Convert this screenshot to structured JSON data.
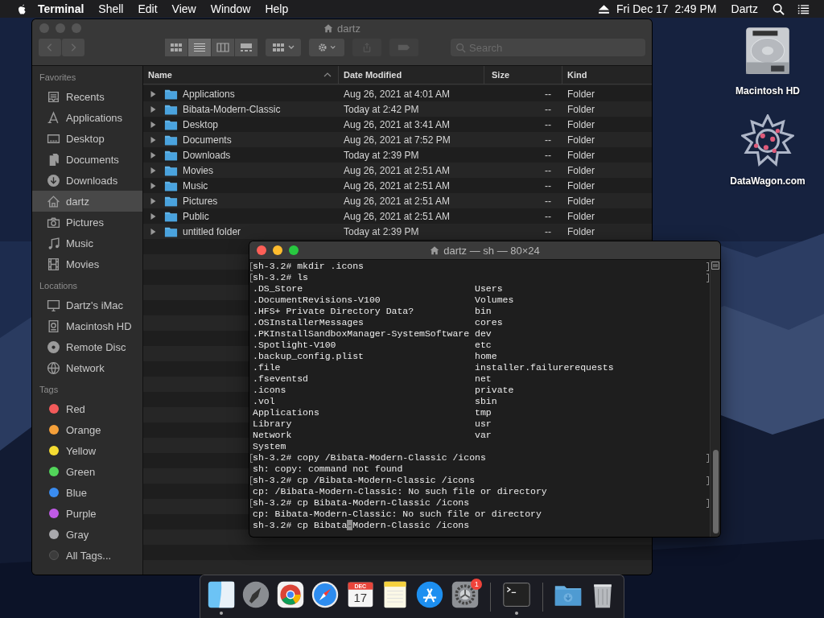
{
  "menu_bar": {
    "app": "Terminal",
    "menus": [
      "Shell",
      "Edit",
      "View",
      "Window",
      "Help"
    ],
    "clock": "Fri Dec 17  2:49 PM",
    "user": "Dartz"
  },
  "finder": {
    "title": "dartz",
    "views": [
      {
        "selected": false
      },
      {
        "selected": true
      },
      {
        "selected": false
      },
      {
        "selected": false
      }
    ],
    "search": {
      "placeholder": "Search"
    },
    "sidebar": [
      {
        "heading": "Favorites",
        "items": [
          {
            "label": "Recents",
            "selected": false
          },
          {
            "label": "Applications",
            "selected": false
          },
          {
            "label": "Desktop",
            "selected": false
          },
          {
            "label": "Documents",
            "selected": false
          },
          {
            "label": "Downloads",
            "selected": false
          },
          {
            "label": "dartz",
            "selected": true
          },
          {
            "label": "Pictures",
            "selected": false
          },
          {
            "label": "Music",
            "selected": false
          },
          {
            "label": "Movies",
            "selected": false
          }
        ]
      },
      {
        "heading": "Locations",
        "items": [
          {
            "label": "Dartz's iMac",
            "selected": false
          },
          {
            "label": "Macintosh HD",
            "selected": false
          },
          {
            "label": "Remote Disc",
            "selected": false
          },
          {
            "label": "Network",
            "selected": false
          }
        ]
      }
    ],
    "tags": {
      "heading": "Tags",
      "items": [
        {
          "label": "Red",
          "color": "#f25a5a"
        },
        {
          "label": "Orange",
          "color": "#f5a03a"
        },
        {
          "label": "Yellow",
          "color": "#f5dc32"
        },
        {
          "label": "Green",
          "color": "#52d65a"
        },
        {
          "label": "Blue",
          "color": "#3a8cf0"
        },
        {
          "label": "Purple",
          "color": "#c05ae6"
        },
        {
          "label": "Gray",
          "color": "#a8a8ac"
        }
      ],
      "all": "All Tags..."
    },
    "columns": [
      "Name",
      "Date Modified",
      "Size",
      "Kind"
    ],
    "rows": [
      {
        "name": "Applications",
        "date": "Aug 26, 2021 at 4:01 AM",
        "size": "--",
        "kind": "Folder",
        "expanded": false,
        "selected": false
      },
      {
        "name": "Bibata-Modern-Classic",
        "date": "Today at 2:42 PM",
        "size": "--",
        "kind": "Folder",
        "expanded": false,
        "selected": false
      },
      {
        "name": "Desktop",
        "date": "Aug 26, 2021 at 3:41 AM",
        "size": "--",
        "kind": "Folder",
        "expanded": false,
        "selected": false
      },
      {
        "name": "Documents",
        "date": "Aug 26, 2021 at 7:52 PM",
        "size": "--",
        "kind": "Folder",
        "expanded": false,
        "selected": false
      },
      {
        "name": "Downloads",
        "date": "Today at 2:39 PM",
        "size": "--",
        "kind": "Folder",
        "expanded": false,
        "selected": false
      },
      {
        "name": "Movies",
        "date": "Aug 26, 2021 at 2:51 AM",
        "size": "--",
        "kind": "Folder",
        "expanded": false,
        "selected": false
      },
      {
        "name": "Music",
        "date": "Aug 26, 2021 at 2:51 AM",
        "size": "--",
        "kind": "Folder",
        "expanded": false,
        "selected": false
      },
      {
        "name": "Pictures",
        "date": "Aug 26, 2021 at 2:51 AM",
        "size": "--",
        "kind": "Folder",
        "expanded": false,
        "selected": false
      },
      {
        "name": "Public",
        "date": "Aug 26, 2021 at 2:51 AM",
        "size": "--",
        "kind": "Folder",
        "expanded": false,
        "selected": false
      },
      {
        "name": "untitled folder",
        "date": "Today at 2:39 PM",
        "size": "--",
        "kind": "Folder",
        "expanded": false,
        "selected": false
      }
    ]
  },
  "terminal": {
    "title": "dartz — sh — 80×24",
    "lines": [
      {
        "kind": "line",
        "text": "sh-3.2# mkdir .icons",
        "marked": true
      },
      {
        "kind": "line",
        "text": "sh-3.2# ls",
        "marked": true
      },
      {
        "kind": "columns",
        "columns": [
          ".DS_Store",
          "Users"
        ],
        "marked": false
      },
      {
        "kind": "columns",
        "columns": [
          ".DocumentRevisions-V100",
          "Volumes"
        ],
        "marked": false
      },
      {
        "kind": "columns",
        "columns": [
          ".HFS+ Private Directory Data?",
          "bin"
        ],
        "marked": false
      },
      {
        "kind": "columns",
        "columns": [
          ".OSInstallerMessages",
          "cores"
        ],
        "marked": false
      },
      {
        "kind": "columns",
        "columns": [
          ".PKInstallSandboxManager-SystemSoftware",
          "dev"
        ],
        "marked": false
      },
      {
        "kind": "columns",
        "columns": [
          ".Spotlight-V100",
          "etc"
        ],
        "marked": false
      },
      {
        "kind": "columns",
        "columns": [
          ".backup_config.plist",
          "home"
        ],
        "marked": false
      },
      {
        "kind": "columns",
        "columns": [
          ".file",
          "installer.failurerequests"
        ],
        "marked": false
      },
      {
        "kind": "columns",
        "columns": [
          ".fseventsd",
          "net"
        ],
        "marked": false
      },
      {
        "kind": "columns",
        "columns": [
          ".icons",
          "private"
        ],
        "marked": false
      },
      {
        "kind": "columns",
        "columns": [
          ".vol",
          "sbin"
        ],
        "marked": false
      },
      {
        "kind": "columns",
        "columns": [
          "Applications",
          "tmp"
        ],
        "marked": false
      },
      {
        "kind": "columns",
        "columns": [
          "Library",
          "usr"
        ],
        "marked": false
      },
      {
        "kind": "columns",
        "columns": [
          "Network",
          "var"
        ],
        "marked": false
      },
      {
        "kind": "line",
        "text": "System",
        "marked": false
      },
      {
        "kind": "line",
        "text": "sh-3.2# copy /Bibata-Modern-Classic /icons",
        "marked": true
      },
      {
        "kind": "line",
        "text": "sh: copy: command not found",
        "marked": false
      },
      {
        "kind": "line",
        "text": "sh-3.2# cp /Bibata-Modern-Classic /icons",
        "marked": true
      },
      {
        "kind": "line",
        "text": "cp: /Bibata-Modern-Classic: No such file or directory",
        "marked": false
      },
      {
        "kind": "line",
        "text": "sh-3.2# cp Bibata-Modern-Classic /icons",
        "marked": true
      },
      {
        "kind": "line",
        "text": "cp: Bibata-Modern-Classic: No such file or directory",
        "marked": false
      },
      {
        "kind": "input",
        "text": "sh-3.2# cp Bibata",
        "cursor": "-",
        "rest": "Modern-Classic /icons",
        "marked": false
      }
    ]
  },
  "desktop": [
    {
      "label": "Macintosh HD"
    },
    {
      "label": "DataWagon.com"
    }
  ],
  "dock": {
    "items": [
      {
        "running": true
      },
      {
        "running": false
      },
      {
        "running": false
      },
      {
        "running": false
      },
      {
        "running": false,
        "month": "DEC",
        "day": "17"
      },
      {
        "running": false
      },
      {
        "running": false
      },
      {
        "running": false,
        "badge": "1"
      },
      {
        "running": true
      },
      {
        "running": false
      },
      {
        "running": false
      }
    ]
  }
}
